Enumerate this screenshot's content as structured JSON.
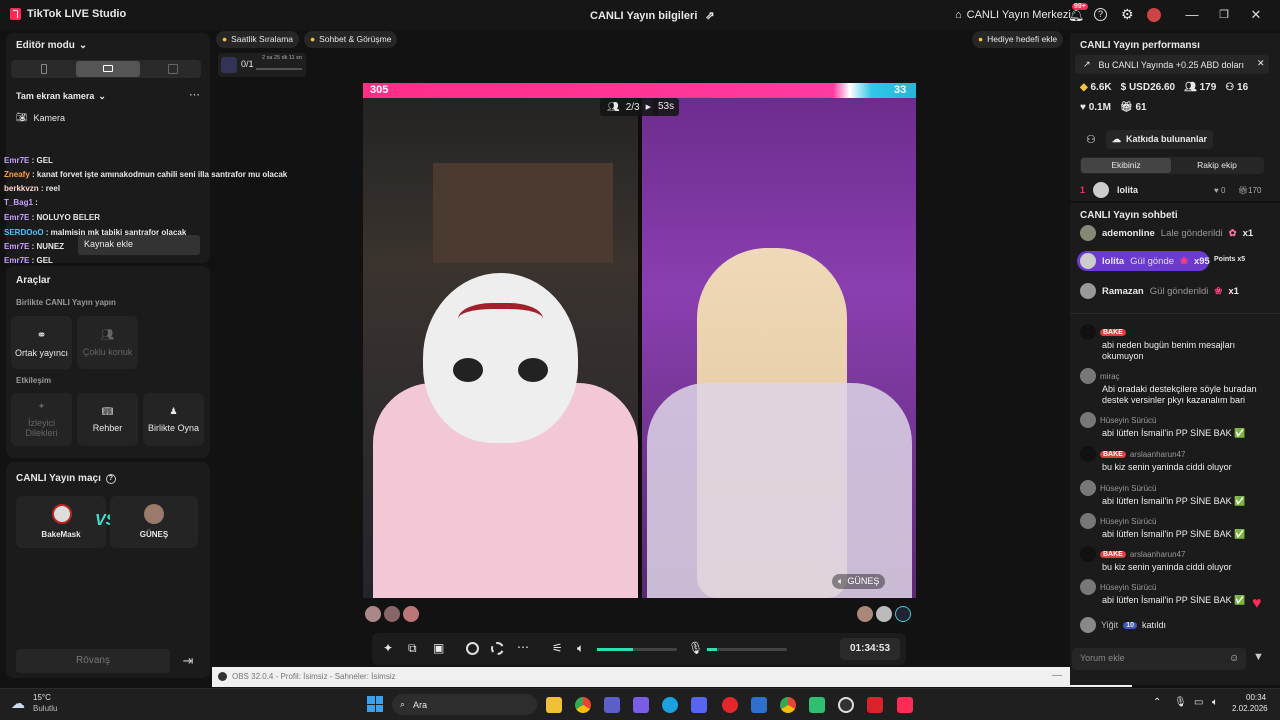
{
  "window": {
    "title": "TikTok LIVE Studio",
    "center_title": "CANLI Yayın bilgileri",
    "center_label": "CANLI Yayın Merkezi",
    "notif_count": "99+"
  },
  "left": {
    "editor_mode": "Editör modu",
    "camera_section": "Tam ekran kamera",
    "camera_item": "Kamera",
    "add_source_tooltip": "Kaynak ekle",
    "chat": [
      {
        "user": "Emr7E",
        "text": ": GEL"
      },
      {
        "user": "Zneafy",
        "text": ": kanat forvet işte amınakodmun cahili seni illa santrafor mu olacak"
      },
      {
        "user": "berkkvzn",
        "text": ": reel"
      },
      {
        "user": "T_Bag1",
        "text": ":"
      },
      {
        "user": "Emr7E",
        "text": ": NOLUYO BELER"
      },
      {
        "user": "SERDOoO",
        "text": ": malmisin mk tabiki santrafor olacak"
      },
      {
        "user": "Emr7E",
        "text": ": NUNEZ"
      },
      {
        "user": "Emr7E",
        "text": ": GEL"
      }
    ],
    "tools_title": "Araçlar",
    "together_title": "Birlikte CANLI Yayın yapın",
    "tools_row1": [
      "Ortak yayıncı",
      "Çoklu konuk"
    ],
    "interaction_title": "Etkileşim",
    "tools_row2": [
      "İzleyici Dilekleri",
      "Rehber",
      "Birlikte Oyna"
    ],
    "match_title": "CANLI Yayın maçı",
    "match_left": "BakeMask",
    "match_right": "GÜNEŞ",
    "rematch": "Rövanş"
  },
  "top_tabs": [
    "Saatlik Sıralama",
    "Sohbet & Görüşme"
  ],
  "gift_goal": "Hediye hedefi ekle",
  "mission": {
    "count": "0/1",
    "timer": "2 sa 25 dk 11 sn"
  },
  "battle": {
    "left_score": "305",
    "right_score": "33",
    "round": "2/3",
    "time": "53s",
    "right_name": "GÜNEŞ"
  },
  "controls": {
    "timer": "01:34:53"
  },
  "obs": {
    "title": "OBS 32.0.4 - Profil: İsimsiz - Sahneler: İsimsiz"
  },
  "right": {
    "perf_title": "CANLI Yayın performansı",
    "perf_banner": "Bu CANLI Yayında +0.25 ABD doları",
    "stats1": [
      "6.6K",
      "USD26.60",
      "179",
      "16"
    ],
    "stats2": [
      "0.1M",
      "61"
    ],
    "contributors_btn": "Katkıda bulunanlar",
    "tabs": [
      "Ekibiniz",
      "Rakip ekip"
    ],
    "rank": {
      "pos": "1",
      "name": "lolita",
      "likes": "0",
      "gifts": "170"
    },
    "chat_title": "CANLI Yayın sohbeti",
    "gifts": [
      {
        "name": "ademonline",
        "action": "Lale gönderildi",
        "count": "x1"
      },
      {
        "name": "lolita",
        "action": "Gül gönde",
        "count": "x95",
        "extra": "Points x5"
      },
      {
        "name": "Ramazan",
        "action": "Gül gönderildi",
        "count": "x1"
      }
    ],
    "messages": [
      {
        "badge": "BAKE",
        "name": "",
        "text": "abi neden bugün benim mesajları okumuyon"
      },
      {
        "badge": "",
        "name": "miraç",
        "text": "Abi oradaki destekçilere söyle buradan destek versinler pkyı kazanalım bari"
      },
      {
        "badge": "",
        "name": "Hüseyin Sürücü",
        "text": "abi lütfen İsmail'in PP SİNE BAK ✅"
      },
      {
        "badge": "BAKE",
        "name": "arslaanharun47",
        "text": "bu kiz senin yaninda ciddi oluyor"
      },
      {
        "badge": "",
        "name": "Hüseyin Sürücü",
        "text": "abi lütfen İsmail'in PP SİNE BAK ✅"
      },
      {
        "badge": "",
        "name": "Hüseyin Sürücü",
        "text": "abi lütfen İsmail'in PP SİNE BAK ✅"
      },
      {
        "badge": "BAKE",
        "name": "arslaanharun47",
        "text": "bu kiz senin yaninda ciddi oluyor"
      },
      {
        "badge": "",
        "name": "Hüseyin Sürücü",
        "text": "abi lütfen İsmail'in PP SİNE BAK ✅"
      }
    ],
    "joined": {
      "name": "Yiğit",
      "level": "10",
      "text": "katıldı"
    },
    "comment_placeholder": "Yorum ekle"
  },
  "taskbar": {
    "temp": "15°C",
    "weather": "Bulutlu",
    "search": "Ara",
    "time": "00:34",
    "date": "2.02.2026"
  }
}
